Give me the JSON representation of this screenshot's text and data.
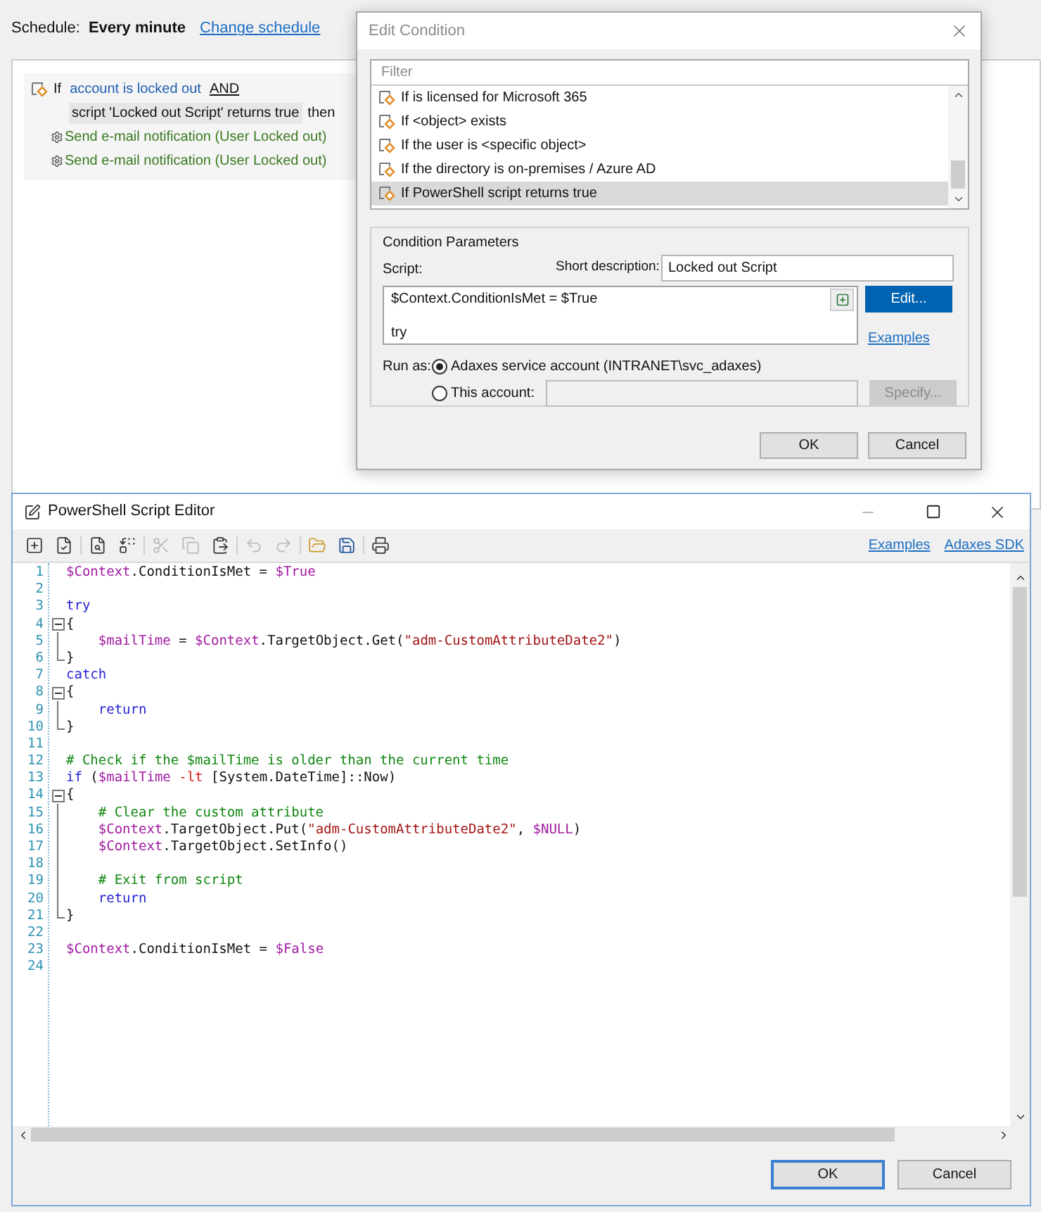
{
  "schedule": {
    "label": "Schedule:",
    "value": "Every minute",
    "link": "Change schedule"
  },
  "rule": {
    "if": "If",
    "condition_1": "account is locked out",
    "operator": "AND",
    "condition_2": "script 'Locked out Script' returns true",
    "then": "then",
    "actions": [
      "Send e-mail notification (User Locked out)",
      "Send e-mail notification (User Locked out)"
    ]
  },
  "edit_condition": {
    "title": "Edit Condition",
    "filter": {
      "placeholder": "Filter"
    },
    "conditions": [
      {
        "label": "If is licensed for Microsoft 365",
        "selected": false
      },
      {
        "label": "If <object> exists",
        "selected": false
      },
      {
        "label": "If the user is <specific object>",
        "selected": false
      },
      {
        "label": "If the directory is on-premises / Azure AD",
        "selected": false
      },
      {
        "label": "If PowerShell script returns true",
        "selected": true
      }
    ],
    "parameters": {
      "legend": "Condition Parameters",
      "script_label": "Script:",
      "short_description_label": "Short description:",
      "short_description": "Locked out Script",
      "script_preview": "$Context.ConditionIsMet = $True\n\ntry",
      "edit": "Edit...",
      "examples": "Examples",
      "run_as_label": "Run as:",
      "run_as": [
        {
          "label": "Adaxes service account (INTRANET\\svc_adaxes)",
          "selected": true
        },
        {
          "label": "This account:",
          "selected": false
        }
      ],
      "specify": {
        "label": "Specify...",
        "disabled": true
      }
    },
    "buttons": [
      "OK",
      "Cancel"
    ]
  },
  "script_editor": {
    "title": "PowerShell Script Editor",
    "toolbar_groups": [
      {
        "buttons": [
          {
            "kind": "insert",
            "disabled": false
          },
          {
            "kind": "check",
            "disabled": false
          }
        ]
      },
      {
        "buttons": [
          {
            "kind": "find",
            "disabled": false
          },
          {
            "kind": "replace",
            "disabled": false
          }
        ]
      },
      {
        "buttons": [
          {
            "kind": "cut",
            "disabled": true
          },
          {
            "kind": "copy",
            "disabled": true
          },
          {
            "kind": "paste",
            "disabled": false
          }
        ]
      },
      {
        "buttons": [
          {
            "kind": "undo",
            "disabled": true
          },
          {
            "kind": "redo",
            "disabled": true
          }
        ]
      },
      {
        "buttons": [
          {
            "kind": "open",
            "disabled": false
          },
          {
            "kind": "save",
            "disabled": false
          }
        ]
      },
      {
        "buttons": [
          {
            "kind": "print",
            "disabled": false
          }
        ]
      }
    ],
    "links": [
      "Examples",
      "Adaxes SDK"
    ],
    "lines": [
      {
        "number": "1",
        "kind": "plain",
        "tokens": [
          {
            "kind": "var",
            "text": "$Context"
          },
          {
            "kind": "plain",
            "text": ".ConditionIsMet = "
          },
          {
            "kind": "var",
            "text": "$True"
          }
        ]
      },
      {
        "number": "2",
        "kind": "plain"
      },
      {
        "number": "3",
        "kind": "plain",
        "tokens": [
          {
            "kind": "keyword",
            "text": "try"
          }
        ]
      },
      {
        "number": "4",
        "kind": "fold_start",
        "tokens": [
          {
            "kind": "plain",
            "text": "{"
          }
        ]
      },
      {
        "number": "5",
        "kind": "fold_body",
        "indented": true,
        "tokens": [
          {
            "kind": "var",
            "text": "$mailTime"
          },
          {
            "kind": "plain",
            "text": " = "
          },
          {
            "kind": "var",
            "text": "$Context"
          },
          {
            "kind": "plain",
            "text": ".TargetObject.Get("
          },
          {
            "kind": "string",
            "text": "\"adm-CustomAttributeDate2\""
          },
          {
            "kind": "plain",
            "text": ")"
          }
        ]
      },
      {
        "number": "6",
        "kind": "fold_end",
        "tokens": [
          {
            "kind": "plain",
            "text": "}"
          }
        ]
      },
      {
        "number": "7",
        "kind": "plain",
        "tokens": [
          {
            "kind": "keyword",
            "text": "catch"
          }
        ]
      },
      {
        "number": "8",
        "kind": "fold_start",
        "tokens": [
          {
            "kind": "plain",
            "text": "{"
          }
        ]
      },
      {
        "number": "9",
        "kind": "fold_body",
        "indented": true,
        "tokens": [
          {
            "kind": "keyword",
            "text": "return"
          }
        ]
      },
      {
        "number": "10",
        "kind": "fold_end",
        "tokens": [
          {
            "kind": "plain",
            "text": "}"
          }
        ]
      },
      {
        "number": "11",
        "kind": "plain"
      },
      {
        "number": "12",
        "kind": "plain",
        "tokens": [
          {
            "kind": "comment",
            "text": "# Check if the $mailTime is older than the current time"
          }
        ]
      },
      {
        "number": "13",
        "kind": "plain",
        "tokens": [
          {
            "kind": "keyword",
            "text": "if"
          },
          {
            "kind": "plain",
            "text": " ("
          },
          {
            "kind": "var",
            "text": "$mailTime"
          },
          {
            "kind": "op",
            "text": " -lt"
          },
          {
            "kind": "plain",
            "text": " [System.DateTime]::Now)"
          }
        ]
      },
      {
        "number": "14",
        "kind": "fold_start",
        "tokens": [
          {
            "kind": "plain",
            "text": "{"
          }
        ]
      },
      {
        "number": "15",
        "kind": "fold_body",
        "indented": true,
        "tokens": [
          {
            "kind": "comment",
            "text": "# Clear the custom attribute"
          }
        ]
      },
      {
        "number": "16",
        "kind": "fold_body",
        "indented": true,
        "tokens": [
          {
            "kind": "var",
            "text": "$Context"
          },
          {
            "kind": "plain",
            "text": ".TargetObject.Put("
          },
          {
            "kind": "string",
            "text": "\"adm-CustomAttributeDate2\""
          },
          {
            "kind": "plain",
            "text": ", "
          },
          {
            "kind": "var",
            "text": "$NULL"
          },
          {
            "kind": "plain",
            "text": ")"
          }
        ]
      },
      {
        "number": "17",
        "kind": "fold_body",
        "indented": true,
        "tokens": [
          {
            "kind": "var",
            "text": "$Context"
          },
          {
            "kind": "plain",
            "text": ".TargetObject.SetInfo()"
          }
        ]
      },
      {
        "number": "18",
        "kind": "fold_body"
      },
      {
        "number": "19",
        "kind": "fold_body",
        "indented": true,
        "tokens": [
          {
            "kind": "comment",
            "text": "# Exit from script"
          }
        ]
      },
      {
        "number": "20",
        "kind": "fold_body",
        "indented": true,
        "tokens": [
          {
            "kind": "keyword",
            "text": "return"
          }
        ]
      },
      {
        "number": "21",
        "kind": "fold_end",
        "tokens": [
          {
            "kind": "plain",
            "text": "}"
          }
        ]
      },
      {
        "number": "22",
        "kind": "plain"
      },
      {
        "number": "23",
        "kind": "plain",
        "tokens": [
          {
            "kind": "var",
            "text": "$Context"
          },
          {
            "kind": "plain",
            "text": ".ConditionIsMet = "
          },
          {
            "kind": "var",
            "text": "$False"
          }
        ]
      },
      {
        "number": "24",
        "kind": "plain"
      }
    ],
    "buttons": [
      {
        "label": "OK",
        "default": true
      },
      {
        "label": "Cancel",
        "default": false
      }
    ]
  }
}
